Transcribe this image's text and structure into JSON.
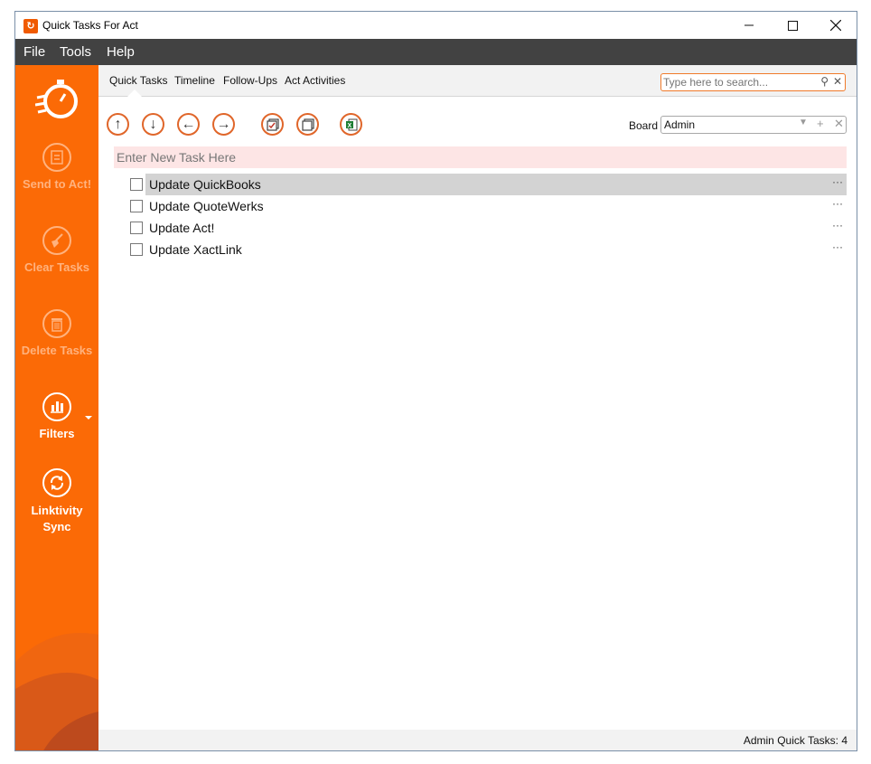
{
  "window": {
    "title": "Quick Tasks For Act"
  },
  "menu": {
    "items": [
      "File",
      "Tools",
      "Help"
    ]
  },
  "sidebar": {
    "buttons": [
      {
        "label": "Send to Act!",
        "icon": "send-icon",
        "enabled": false
      },
      {
        "label": "Clear Tasks",
        "icon": "broom-icon",
        "enabled": false
      },
      {
        "label": "Delete Tasks",
        "icon": "trash-icon",
        "enabled": false
      },
      {
        "label": "Filters",
        "icon": "chart-filter-icon",
        "enabled": true
      },
      {
        "label": "Linktivity Sync",
        "icon": "sync-icon",
        "enabled": true
      }
    ]
  },
  "tabs": [
    "Quick Tasks",
    "Timeline",
    "Follow-Ups",
    "Act Activities"
  ],
  "search": {
    "placeholder": "Type here to search..."
  },
  "board": {
    "label": "Board",
    "value": "Admin"
  },
  "new_task": {
    "placeholder": "Enter New Task Here"
  },
  "tasks": [
    {
      "label": "Update QuickBooks",
      "selected": true,
      "more": "···"
    },
    {
      "label": "Update QuoteWerks",
      "selected": false,
      "more": "···"
    },
    {
      "label": "Update Act!",
      "selected": false,
      "more": "···"
    },
    {
      "label": "Update XactLink",
      "selected": false,
      "more": "···"
    }
  ],
  "status": {
    "text": "Admin Quick Tasks: 4"
  },
  "colors": {
    "accent": "#fb6a06",
    "menubar": "#424242",
    "new_task_bg": "#fde5e5",
    "selected_row": "#d3d3d3"
  }
}
